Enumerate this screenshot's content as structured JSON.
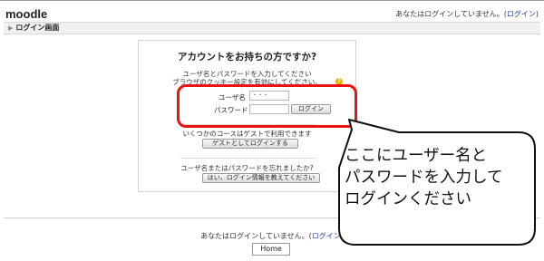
{
  "header": {
    "site_title": "moodle",
    "login_status": "あなたはログインしていません。",
    "login_link": "ログイン"
  },
  "breadcrumb": {
    "current": "ログイン画面"
  },
  "login_box": {
    "heading": "アカウントをお持ちの方ですか?",
    "instruction_line1": "ユーザ名とパスワードを入力してください",
    "instruction_line2": "ブラウザのクッキー設定を有効にしてください。",
    "username_label": "ユーザ名",
    "username_value": "・・・",
    "password_label": "パスワード",
    "login_button": "ログイン",
    "guest_text": "いくつかのコースはゲストで利用できます",
    "guest_button": "ゲストとしてログインする",
    "forgot_text": "ユーザ名またはパスワードを忘れましたか?",
    "forgot_button": "はい、ログイン情報を教えてください"
  },
  "callout": {
    "line1": "ここにユーザー名と",
    "line2": "パスワードを入力して",
    "line3": "ログインください"
  },
  "footer": {
    "login_status": "あなたはログインしていません。",
    "login_link": "ログイン",
    "home_button": "Home"
  },
  "colors": {
    "highlight": "#ee1111",
    "link": "#1a3bb3"
  }
}
